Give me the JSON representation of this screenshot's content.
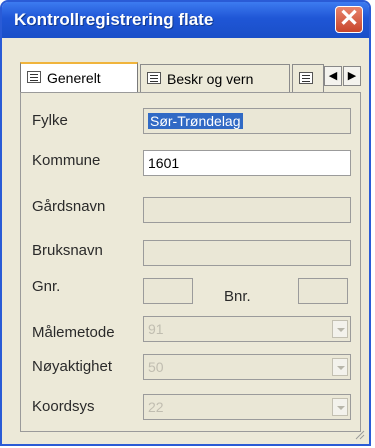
{
  "window": {
    "title": "Kontrollregistrering flate",
    "close_glyph": "✕"
  },
  "tabs": [
    {
      "label": "Generelt",
      "icon": "form-icon",
      "active": true
    },
    {
      "label": "Beskr og vern",
      "icon": "form-icon",
      "active": false
    }
  ],
  "tab_scroll": {
    "left": "◀",
    "right": "▶"
  },
  "fields": {
    "fylke": {
      "label": "Fylke",
      "value": "Sør-Trøndelag"
    },
    "kommune": {
      "label": "Kommune",
      "value": "1601"
    },
    "gardsnavn": {
      "label": "Gårdsnavn",
      "value": ""
    },
    "bruksnavn": {
      "label": "Bruksnavn",
      "value": ""
    },
    "gnr": {
      "label": "Gnr.",
      "value": ""
    },
    "bnr": {
      "label": "Bnr.",
      "value": ""
    },
    "malemetode": {
      "label": "Målemetode",
      "value": "91"
    },
    "noyaktighet": {
      "label": "Nøyaktighet",
      "value": "50"
    },
    "koordsys": {
      "label": "Koordsys",
      "value": "22"
    }
  }
}
